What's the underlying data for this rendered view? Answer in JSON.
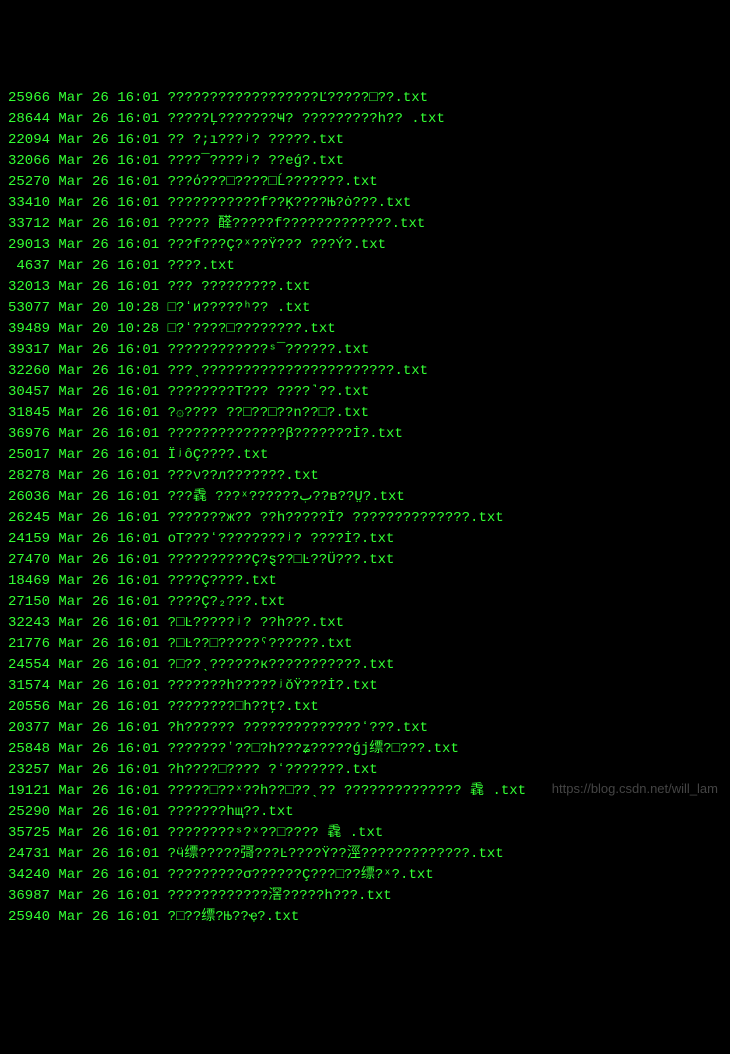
{
  "watermark": "https://blog.csdn.net/will_lam",
  "listing": [
    {
      "size": "25966",
      "month": "Mar",
      "day": "26",
      "time": "16:01",
      "name": "??????????????????Ľ?????□??.txt"
    },
    {
      "size": "28644",
      "month": "Mar",
      "day": "26",
      "time": "16:01",
      "name": "?????Ļ???????Ҹ? ?????????h?? .txt"
    },
    {
      "size": "22094",
      "month": "Mar",
      "day": "26",
      "time": "16:01",
      "name": "?? ?;ı???ʲ? ?????.txt"
    },
    {
      "size": "32066",
      "month": "Mar",
      "day": "26",
      "time": "16:01",
      "name": "????¯????ʲ? ??eǵ?.txt"
    },
    {
      "size": "25270",
      "month": "Mar",
      "day": "26",
      "time": "16:01",
      "name": "???ό???□????□Ĺ???????.txt"
    },
    {
      "size": "33410",
      "month": "Mar",
      "day": "26",
      "time": "16:01",
      "name": "???????????f??Ķ????Њ?ȯ???.txt"
    },
    {
      "size": "33712",
      "month": "Mar",
      "day": "26",
      "time": "16:01",
      "name": "????? 醛?????f?????????????.txt"
    },
    {
      "size": "29013",
      "month": "Mar",
      "day": "26",
      "time": "16:01",
      "name": "???f???Ç?ˣ??Ÿ??? ???Ý?.txt"
    },
    {
      "size": "4637",
      "month": "Mar",
      "day": "26",
      "time": "16:01",
      "name": "????.txt"
    },
    {
      "size": "32013",
      "month": "Mar",
      "day": "26",
      "time": "16:01",
      "name": "??? ?????????.txt"
    },
    {
      "size": "53077",
      "month": "Mar",
      "day": "20",
      "time": "10:28",
      "name": "□?ʻи?????ʰ?? .txt"
    },
    {
      "size": "39489",
      "month": "Mar",
      "day": "20",
      "time": "10:28",
      "name": "□?ʻ????□????????.txt"
    },
    {
      "size": "39317",
      "month": "Mar",
      "day": "26",
      "time": "16:01",
      "name": "????????????ˢ¯??????.txt"
    },
    {
      "size": "32260",
      "month": "Mar",
      "day": "26",
      "time": "16:01",
      "name": "???ˎ???????????????????????.txt"
    },
    {
      "size": "30457",
      "month": "Mar",
      "day": "26",
      "time": "16:01",
      "name": "????????T??? ????˺??.txt"
    },
    {
      "size": "31845",
      "month": "Mar",
      "day": "26",
      "time": "16:01",
      "name": "?۞???? ??□??□??n??□?.txt"
    },
    {
      "size": "36976",
      "month": "Mar",
      "day": "26",
      "time": "16:01",
      "name": "??????????????β???????İ?.txt"
    },
    {
      "size": "25017",
      "month": "Mar",
      "day": "26",
      "time": "16:01",
      "name": "ÏʲôÇ????.txt"
    },
    {
      "size": "28278",
      "month": "Mar",
      "day": "26",
      "time": "16:01",
      "name": "???ν??л???????.txt"
    },
    {
      "size": "26036",
      "month": "Mar",
      "day": "26",
      "time": "16:01",
      "name": "???毳 ???ˣ??????ب??в??Ṳ?.txt"
    },
    {
      "size": "26245",
      "month": "Mar",
      "day": "26",
      "time": "16:01",
      "name": "???????ж?? ??h?????Ï? ??????????????.txt"
    },
    {
      "size": "24159",
      "month": "Mar",
      "day": "26",
      "time": "16:01",
      "name": "οТ???ʻ????????ʲ? ????İ?.txt"
    },
    {
      "size": "27470",
      "month": "Mar",
      "day": "26",
      "time": "16:01",
      "name": "??????????Ç?ȿ??□Ŀ??Ü???.txt"
    },
    {
      "size": "18469",
      "month": "Mar",
      "day": "26",
      "time": "16:01",
      "name": "????Ç????.txt"
    },
    {
      "size": "27150",
      "month": "Mar",
      "day": "26",
      "time": "16:01",
      "name": "????Ç?₂???.txt"
    },
    {
      "size": "32243",
      "month": "Mar",
      "day": "26",
      "time": "16:01",
      "name": "?□Ŀ?????ʲ? ??һ???.txt"
    },
    {
      "size": "21776",
      "month": "Mar",
      "day": "26",
      "time": "16:01",
      "name": "?□Ŀ??□?????ˤ??????.txt"
    },
    {
      "size": "24554",
      "month": "Mar",
      "day": "26",
      "time": "16:01",
      "name": "?□??ˎ??????к???????????.txt"
    },
    {
      "size": "31574",
      "month": "Mar",
      "day": "26",
      "time": "16:01",
      "name": "???????h?????ʲŏŸ???İ?.txt"
    },
    {
      "size": "20556",
      "month": "Mar",
      "day": "26",
      "time": "16:01",
      "name": "????????□h??ţ?.txt"
    },
    {
      "size": "20377",
      "month": "Mar",
      "day": "26",
      "time": "16:01",
      "name": "?h?????? ??????????????ʻ???.txt"
    },
    {
      "size": "25848",
      "month": "Mar",
      "day": "26",
      "time": "16:01",
      "name": "???????ʽ??□?h???ʑ?????ǵj缥?□???.txt"
    },
    {
      "size": "23257",
      "month": "Mar",
      "day": "26",
      "time": "16:01",
      "name": "?h????□???? ?ʻ???????.txt"
    },
    {
      "size": "19121",
      "month": "Mar",
      "day": "26",
      "time": "16:01",
      "name": "?????□??ˣ??h??□??ˎ?? ?????????????? 毳 .txt"
    },
    {
      "size": "25290",
      "month": "Mar",
      "day": "26",
      "time": "16:01",
      "name": "???????hщ??.txt"
    },
    {
      "size": "35725",
      "month": "Mar",
      "day": "26",
      "time": "16:01",
      "name": "????????ˢ?ˣ??□???? 毳 .txt"
    },
    {
      "size": "24731",
      "month": "Mar",
      "day": "26",
      "time": "16:01",
      "name": "?ӵ缥?????彁???Ŀ????Ÿ??涇?????????????.txt"
    },
    {
      "size": "34240",
      "month": "Mar",
      "day": "26",
      "time": "16:01",
      "name": "?????????σ??????Ç???□??缥?ˣ?.txt"
    },
    {
      "size": "36987",
      "month": "Mar",
      "day": "26",
      "time": "16:01",
      "name": "????????????滘?????һ???.txt"
    },
    {
      "size": "25940",
      "month": "Mar",
      "day": "26",
      "time": "16:01",
      "name": "?□??缥?Њ??ҿ?.txt"
    }
  ]
}
